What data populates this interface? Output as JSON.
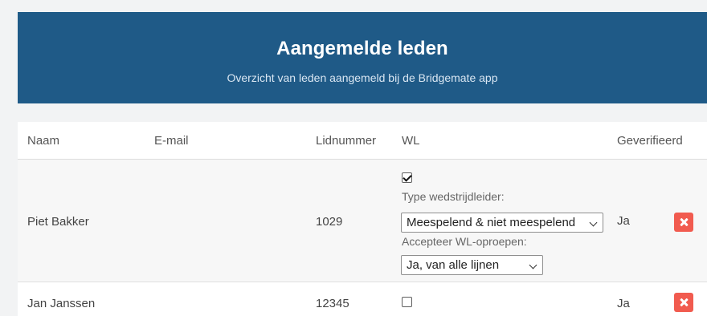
{
  "header": {
    "title": "Aangemelde leden",
    "subtitle": "Overzicht van leden aangemeld bij de Bridgemate app"
  },
  "table": {
    "columns": [
      "Naam",
      "E-mail",
      "Lidnummer",
      "WL",
      "Geverifieerd"
    ],
    "rows": [
      {
        "name": "Piet Bakker",
        "email": "",
        "member_number": "1029",
        "wl_checked": true,
        "wl_type_label": "Type wedstrijdleider:",
        "wl_type_value": "Meespelend & niet meespelend",
        "wl_calls_label": "Accepteer WL-oproepen:",
        "wl_calls_value": "Ja, van alle lijnen",
        "verified": "Ja"
      },
      {
        "name": "Jan Janssen",
        "email": "",
        "member_number": "12345",
        "wl_checked": false,
        "verified": "Ja"
      }
    ]
  },
  "colors": {
    "header_bg": "#1f5a87",
    "delete_button": "#f15b4f"
  },
  "icons": {
    "checked": "checkbox-checked-icon",
    "unchecked": "checkbox-unchecked-icon",
    "delete": "close-icon"
  }
}
